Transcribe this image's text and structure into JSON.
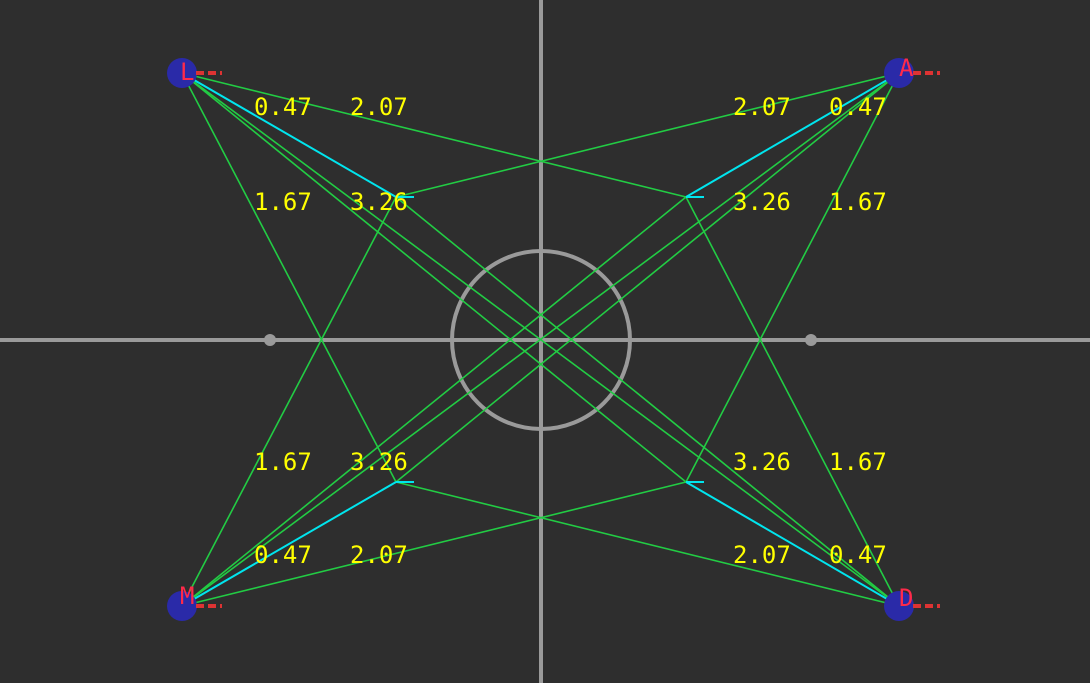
{
  "colors": {
    "background": "#2e2e2e",
    "axis": "#9a9a9a",
    "green_line": "#22cc44",
    "cyan_line": "#00e5ee",
    "label_text": "#ffff00",
    "node_fill": "#2a2aa8",
    "node_letter": "#ff2a4a",
    "node_dash": "#dd3333"
  },
  "nodes": {
    "top_left": {
      "letter": "L"
    },
    "top_right": {
      "letter": "A"
    },
    "bottom_left": {
      "letter": "M"
    },
    "bottom_right": {
      "letter": "D"
    }
  },
  "labels": {
    "tl_a": "0.47",
    "tl_b": "2.07",
    "tl_c": "1.67",
    "tl_d": "3.26",
    "tr_a": "2.07",
    "tr_b": "0.47",
    "tr_c": "3.26",
    "tr_d": "1.67",
    "bl_a": "1.67",
    "bl_b": "3.26",
    "bl_c": "0.47",
    "bl_d": "2.07",
    "br_a": "3.26",
    "br_b": "1.67",
    "br_c": "2.07",
    "br_d": "0.47"
  }
}
